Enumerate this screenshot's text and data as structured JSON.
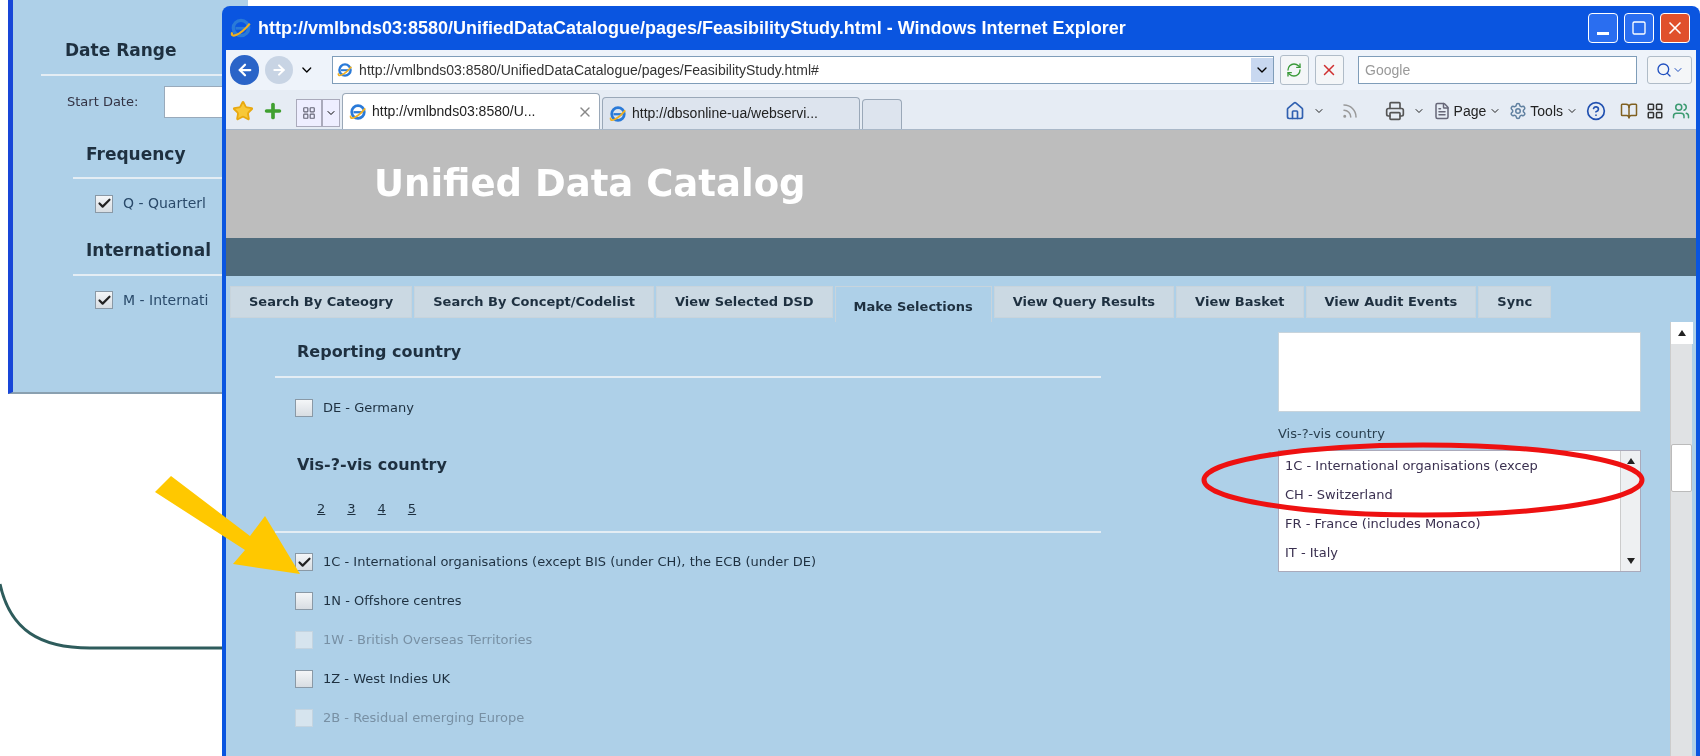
{
  "back_window": {
    "sections": [
      {
        "title": "Date Range",
        "kind": "date",
        "label": "Start Date:"
      },
      {
        "title": "Frequency",
        "kind": "checks",
        "items": [
          {
            "label": "Q - Quarterl",
            "checked": true
          }
        ]
      },
      {
        "title": "International",
        "kind": "checks",
        "items": [
          {
            "label": "M - Internati",
            "checked": true
          }
        ]
      }
    ]
  },
  "window": {
    "title": "http://vmlbnds03:8580/UnifiedDataCatalogue/pages/FeasibilityStudy.html - Windows Internet Explorer"
  },
  "address_bar": {
    "value": "http://vmlbnds03:8580/UnifiedDataCatalogue/pages/FeasibilityStudy.html#"
  },
  "search": {
    "placeholder": "Google"
  },
  "browser_tabs": [
    {
      "label": "http://vmlbnds03:8580/U...",
      "selected": true
    },
    {
      "label": "http://dbsonline-ua/webservi...",
      "selected": false
    }
  ],
  "command_bar": [
    "Page",
    "Tools"
  ],
  "page": {
    "title": "Unified Data Catalog",
    "tabs": [
      {
        "label": "Search By Cateogry",
        "selected": false
      },
      {
        "label": "Search By Concept/Codelist",
        "selected": false
      },
      {
        "label": "View Selected DSD",
        "selected": false
      },
      {
        "label": "Make Selections",
        "selected": true
      },
      {
        "label": "View Query Results",
        "selected": false
      },
      {
        "label": "View Basket",
        "selected": false
      },
      {
        "label": "View Audit Events",
        "selected": false
      },
      {
        "label": "Sync",
        "selected": false
      }
    ],
    "sections": [
      {
        "title": "Reporting country",
        "items": [
          {
            "label": "DE - Germany",
            "checked": false,
            "disabled": false
          }
        ]
      },
      {
        "title": "Vis-?-vis country",
        "pages": [
          "2",
          "3",
          "4",
          "5"
        ],
        "items": [
          {
            "label": "1C - International organisations (except BIS (under CH), the ECB (under DE)",
            "checked": true,
            "disabled": false
          },
          {
            "label": "1N - Offshore centres",
            "checked": false,
            "disabled": false
          },
          {
            "label": "1W - British Overseas Territories",
            "checked": false,
            "disabled": true
          },
          {
            "label": "1Z - West Indies UK",
            "checked": false,
            "disabled": false
          },
          {
            "label": "2B - Residual emerging Europe",
            "checked": false,
            "disabled": true
          }
        ]
      }
    ],
    "side": {
      "label": "Vis-?-vis country",
      "options": [
        "1C - International organisations (excep",
        "CH - Switzerland",
        "FR - France (includes Monaco)",
        "IT - Italy"
      ]
    }
  }
}
